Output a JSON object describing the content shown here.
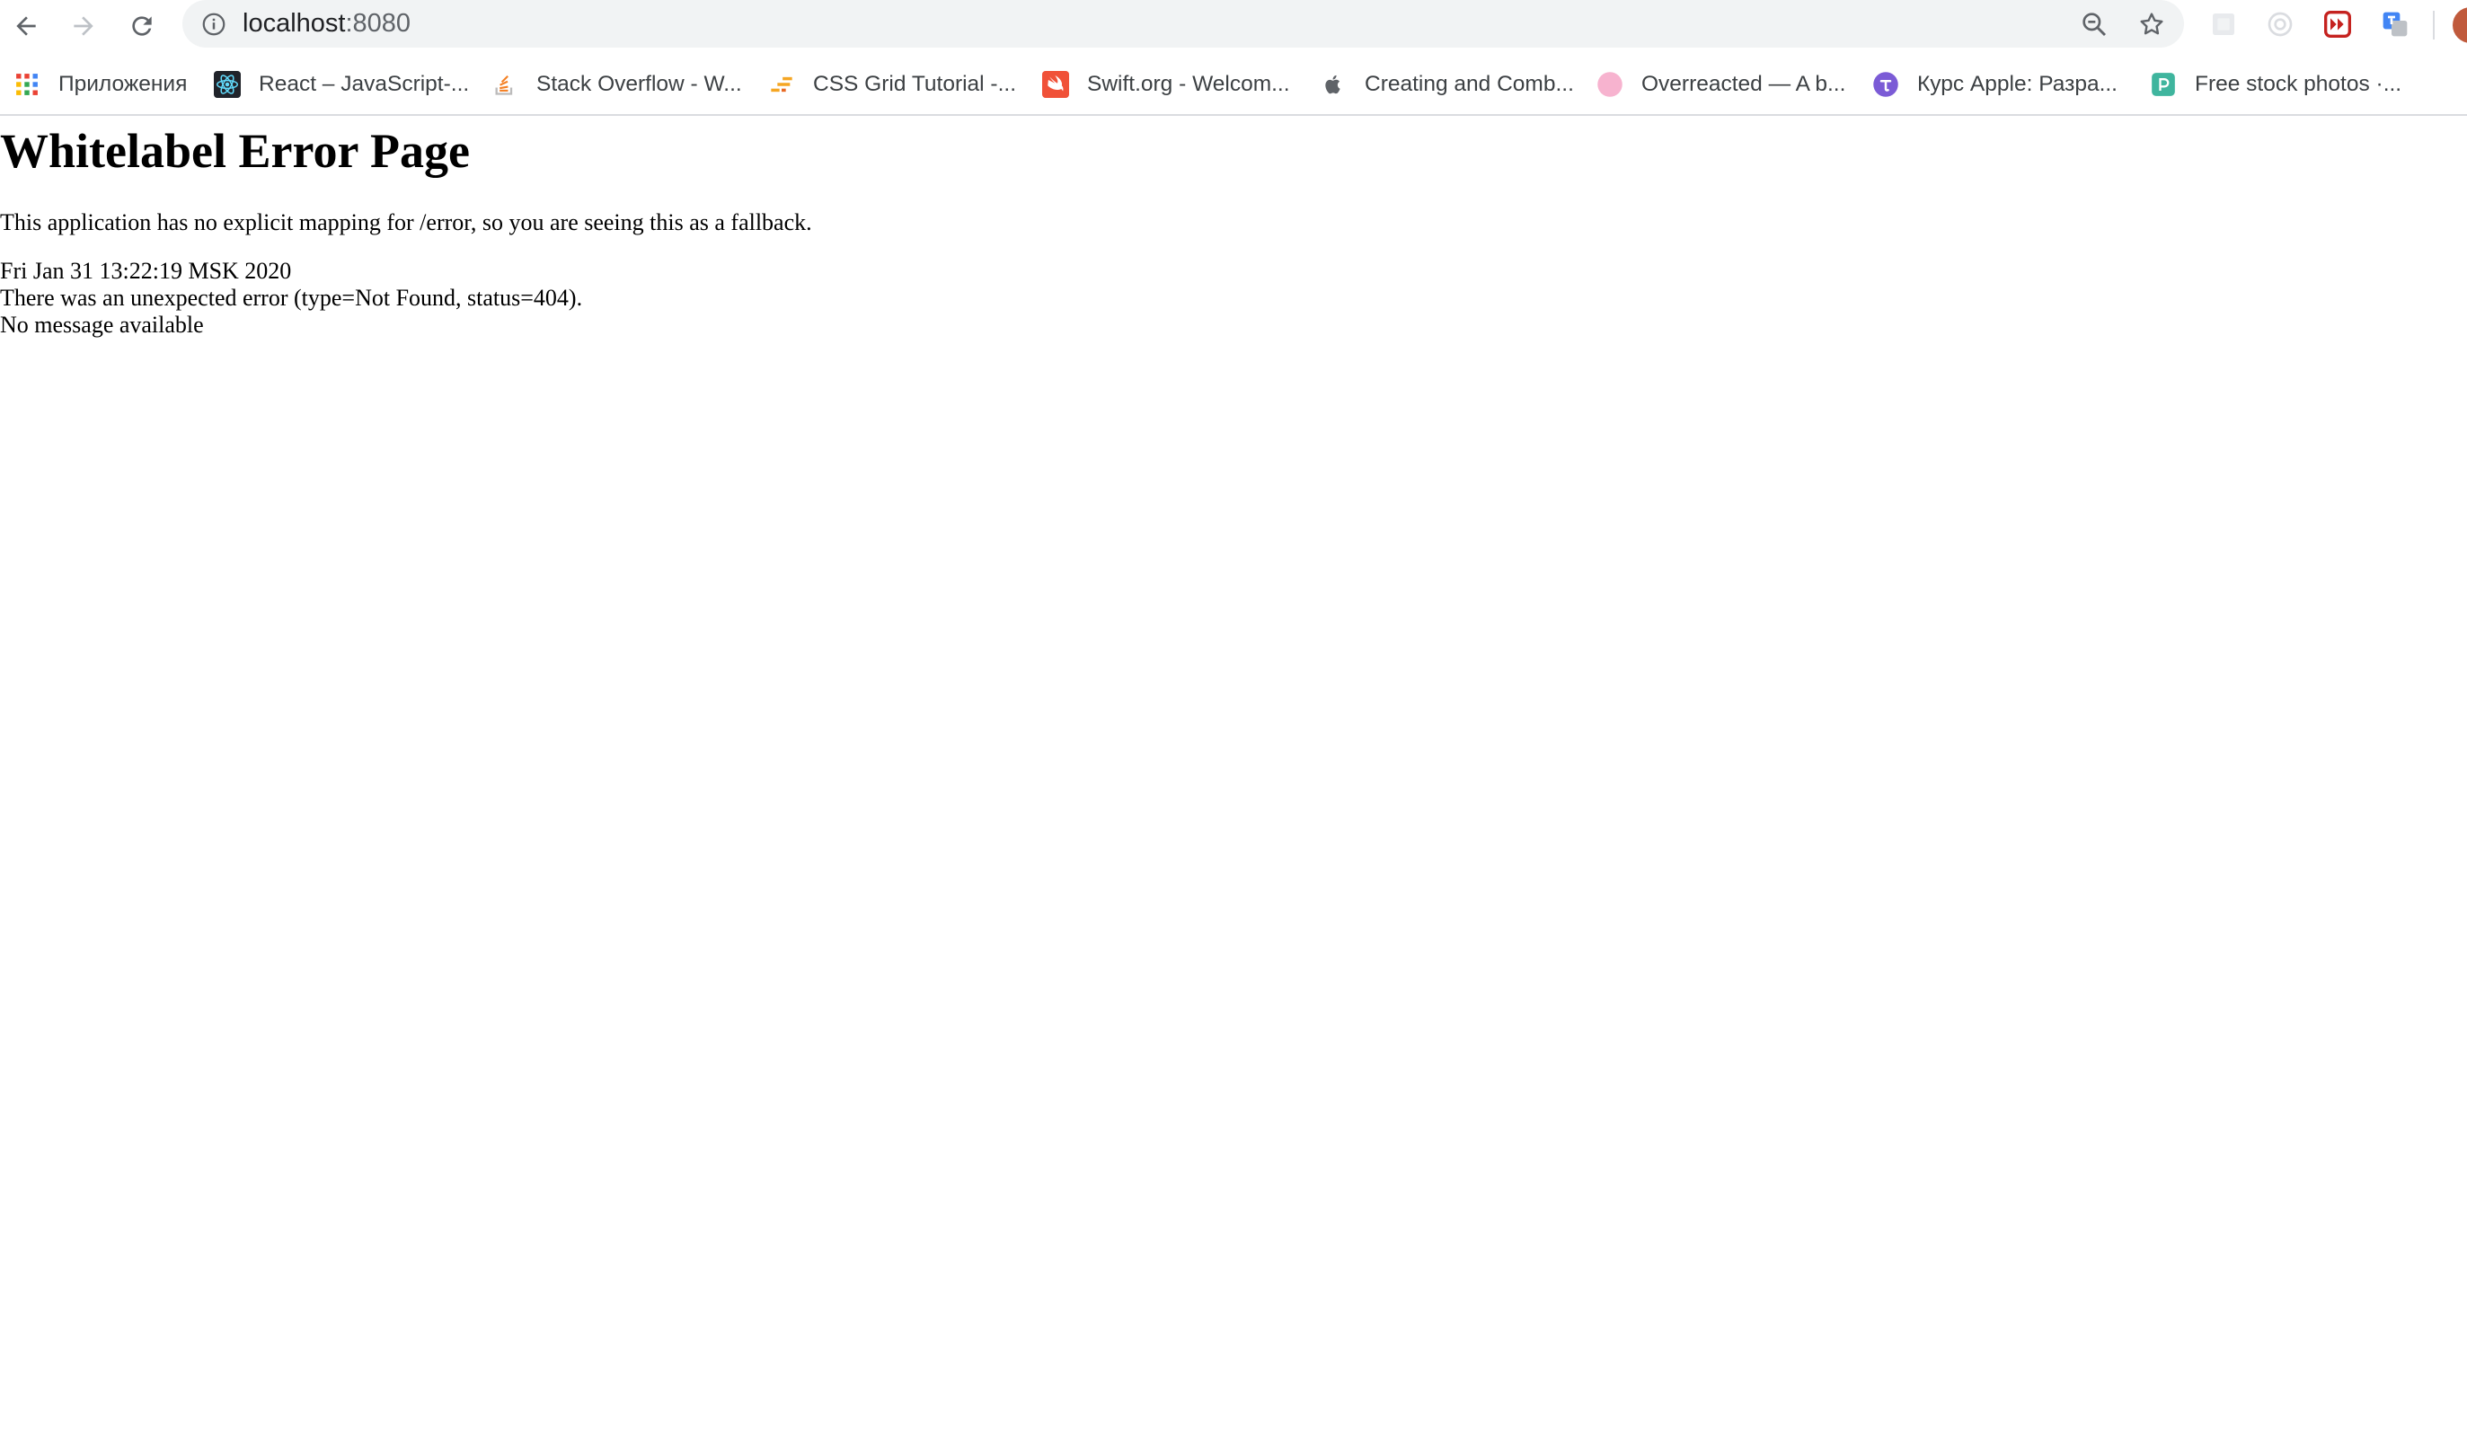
{
  "browser": {
    "url_host": "localhost",
    "url_port": ":8080",
    "bookmarks": [
      {
        "label": "Приложения",
        "icon": "apps-grid-icon"
      },
      {
        "label": "React – JavaScript-...",
        "icon": "react-logo-icon"
      },
      {
        "label": "Stack Overflow - W...",
        "icon": "stackoverflow-logo-icon"
      },
      {
        "label": "CSS Grid Tutorial -...",
        "icon": "css-grid-favicon-icon"
      },
      {
        "label": "Swift.org - Welcom...",
        "icon": "swift-logo-icon"
      },
      {
        "label": "Creating and Comb...",
        "icon": "apple-logo-icon"
      },
      {
        "label": "Overreacted — A b...",
        "icon": "overreacted-favicon-icon"
      },
      {
        "label": "Курс Apple: Разра...",
        "icon": "course-favicon-icon"
      },
      {
        "label": "Free stock photos ·...",
        "icon": "pexels-favicon-icon"
      }
    ]
  },
  "page": {
    "title": "Whitelabel Error Page",
    "description": "This application has no explicit mapping for /error, so you are seeing this as a fallback.",
    "timestamp": "Fri Jan 31 13:22:19 MSK 2020",
    "error_line": "There was an unexpected error (type=Not Found, status=404).",
    "message": "No message available"
  },
  "colors": {
    "chrome_bg": "#ffffff",
    "omnibox_bg": "#f1f3f4",
    "icon_gray": "#5f6368"
  }
}
